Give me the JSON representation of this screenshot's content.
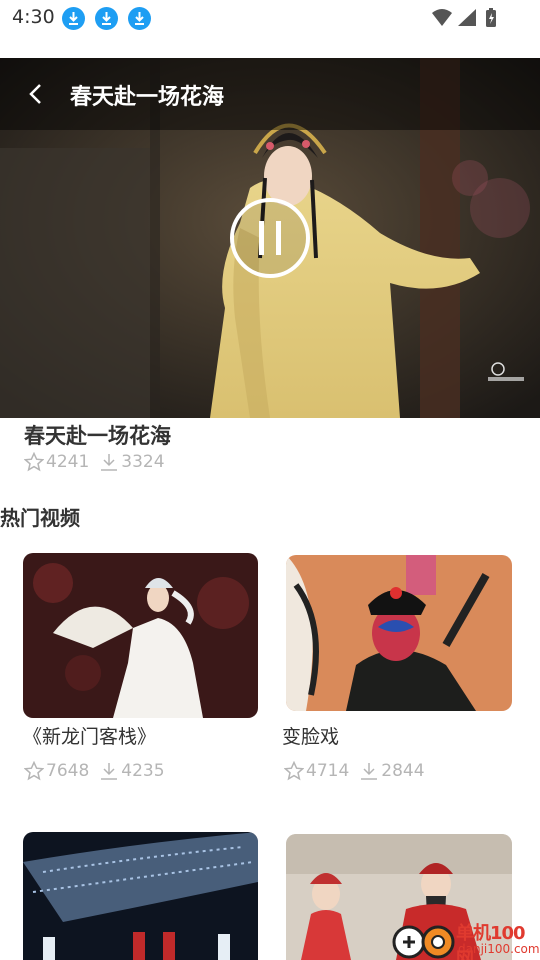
{
  "status": {
    "time": "4:30",
    "download_icons": [
      "download-icon",
      "download-icon",
      "download-icon"
    ]
  },
  "player": {
    "title": "春天赴一场花海",
    "state_icon": "pause-icon"
  },
  "current": {
    "title": "春天赴一场花海",
    "likes": "4241",
    "downloads": "3324"
  },
  "section": {
    "title": "热门视频"
  },
  "videos": [
    {
      "title": "《新龙门客栈》",
      "likes": "7648",
      "downloads": "4235"
    },
    {
      "title": "变脸戏",
      "likes": "4714",
      "downloads": "2844"
    },
    {
      "title": "",
      "likes": "",
      "downloads": ""
    },
    {
      "title": "",
      "likes": "",
      "downloads": ""
    }
  ],
  "footer": {
    "site_name": "单机100网",
    "site_url": "danji100.com"
  },
  "colors": {
    "accent": "#1e9ef3",
    "muted": "#b5b5b5",
    "logo_red": "#e03a2f"
  }
}
